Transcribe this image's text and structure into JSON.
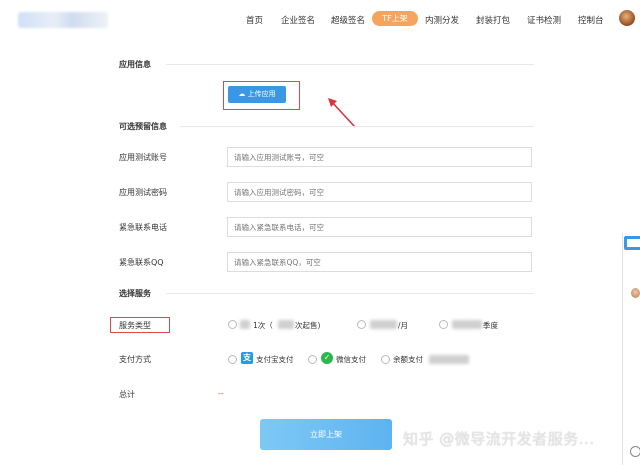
{
  "header": {
    "nav": [
      "首页",
      "企业签名",
      "超级签名",
      "TF上架",
      "内测分发",
      "封装打包",
      "证书检测",
      "控制台"
    ],
    "active_index": 3
  },
  "sections": {
    "app_info": "应用信息",
    "optional_info": "可选预留信息",
    "select_service": "选择服务"
  },
  "upload": {
    "label": "上传应用"
  },
  "fields": [
    {
      "label": "应用测试账号",
      "placeholder": "请输入应用测试账号，可空"
    },
    {
      "label": "应用测试密码",
      "placeholder": "请输入应用测试密码，可空"
    },
    {
      "label": "紧急联系电话",
      "placeholder": "请输入紧急联系电话，可空"
    },
    {
      "label": "紧急联系QQ",
      "placeholder": "请输入紧急联系QQ，可空"
    }
  ],
  "service_type": {
    "label": "服务类型",
    "options": [
      "1次（",
      "次起售)",
      "/月",
      "季度"
    ]
  },
  "payment": {
    "label": "支付方式",
    "options": [
      "支付宝支付",
      "微信支付",
      "余额支付"
    ]
  },
  "total": {
    "label": "总计",
    "value": "--"
  },
  "submit": {
    "label": "立即上架"
  },
  "watermark": "知乎 @微导流开发者服务..."
}
